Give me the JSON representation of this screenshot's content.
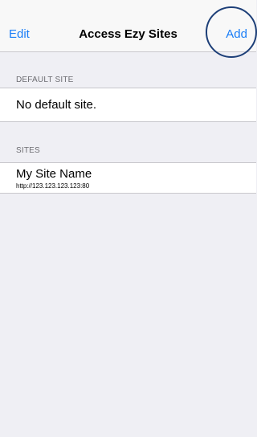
{
  "navbar": {
    "left_button": "Edit",
    "title": "Access Ezy Sites",
    "right_button": "Add"
  },
  "default_section": {
    "header": "DEFAULT SITE",
    "empty_text": "No default site."
  },
  "sites_section": {
    "header": "SITES",
    "items": [
      {
        "name": "My Site Name",
        "url": "http://123.123.123.123:80"
      }
    ]
  }
}
